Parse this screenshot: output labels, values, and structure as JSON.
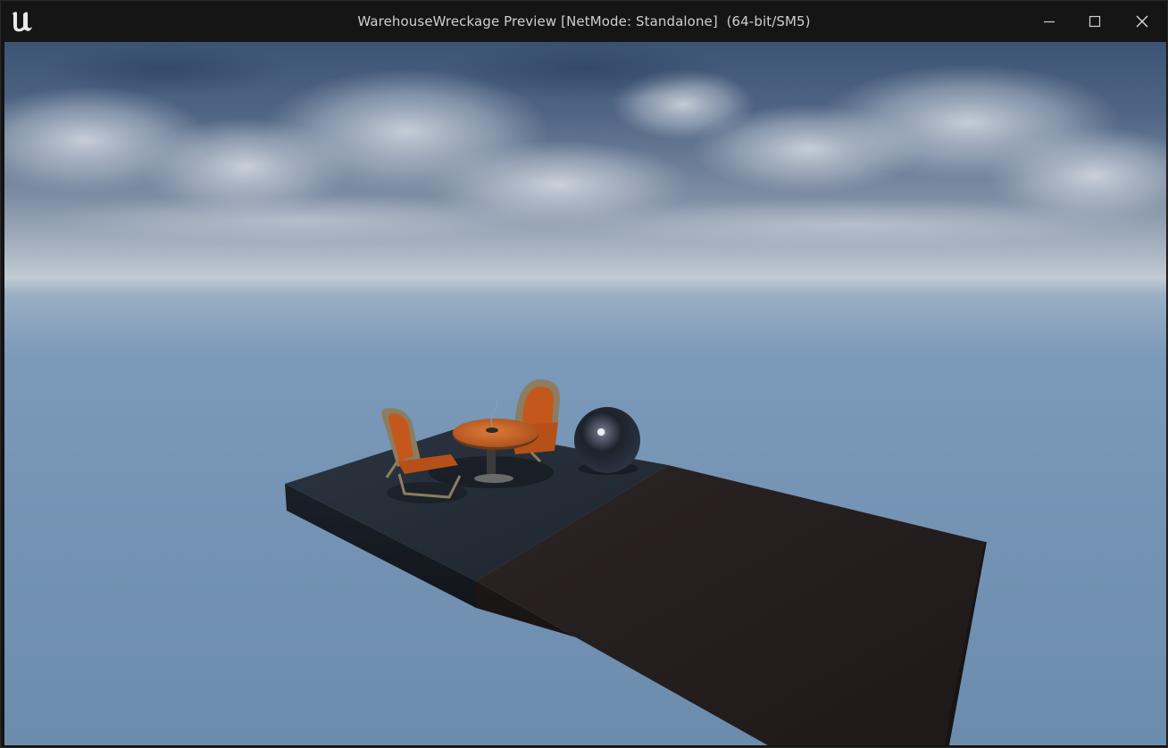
{
  "window": {
    "title": "WarehouseWreckage Preview [NetMode: Standalone]  (64-bit/SM5)",
    "app_icon": "unreal-engine-logo",
    "controls": {
      "minimize_icon": "minimize-icon",
      "maximize_icon": "maximize-icon",
      "close_icon": "close-icon"
    }
  },
  "viewport": {
    "scene_objects": [
      "cloudy-sky",
      "floating-platform",
      "chair-left",
      "chair-back",
      "round-table",
      "chrome-sphere"
    ]
  },
  "colors": {
    "titlebar": "#151515",
    "sky_top": "#3a5272",
    "horizon": "#b7c3cf",
    "fog": "#7897b8",
    "chair_orange": "#c85a1e",
    "table_orange": "#d06b2c"
  }
}
